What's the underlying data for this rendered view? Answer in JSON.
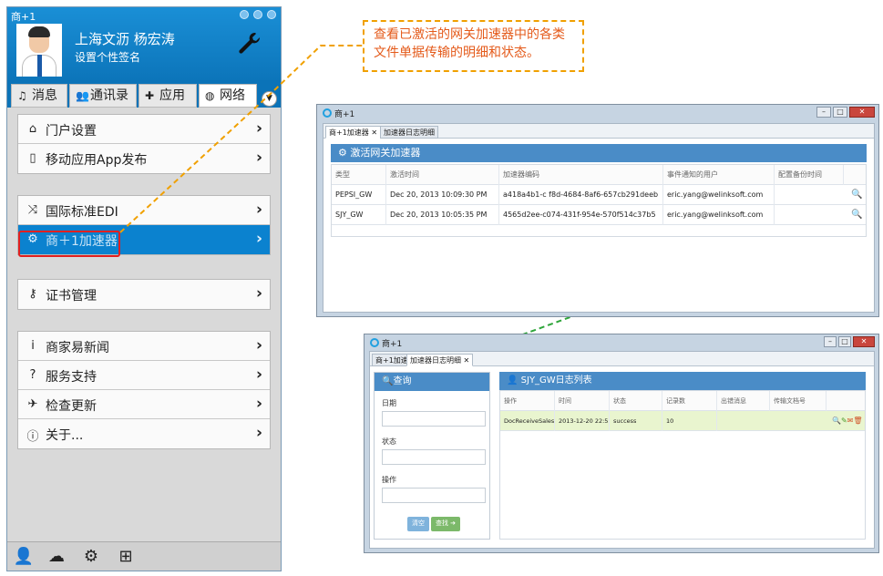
{
  "left_app": {
    "title": "商+1",
    "user_name": "上海文沥 杨宏涛",
    "user_signature": "设置个性签名",
    "tabs": [
      {
        "icon": "bell-icon",
        "label": "消息"
      },
      {
        "icon": "users-icon",
        "label": "通讯录"
      },
      {
        "icon": "puzzle-icon",
        "label": "应用"
      },
      {
        "icon": "globe-icon",
        "label": "网络"
      }
    ],
    "menu_groups": [
      [
        {
          "icon": "home-icon",
          "label": "门户设置"
        },
        {
          "icon": "mobile-icon",
          "label": "移动应用App发布"
        }
      ],
      [
        {
          "icon": "shuffle-icon",
          "label": "国际标准EDI"
        },
        {
          "icon": "gears-icon",
          "label": "商＋1加速器"
        }
      ],
      [
        {
          "icon": "key-icon",
          "label": "证书管理"
        }
      ],
      [
        {
          "icon": "info-i-icon",
          "label": "商家易新闻"
        },
        {
          "icon": "question-icon",
          "label": "服务支持"
        },
        {
          "icon": "plane-icon",
          "label": "检查更新"
        },
        {
          "icon": "info-circle-icon",
          "label": "关于..."
        }
      ]
    ],
    "bottom_icons": [
      "user-icon",
      "cloud-icon",
      "gear-icon",
      "plus-square-icon"
    ]
  },
  "callout": {
    "text": "查看已激活的网关加速器中的各类文件单据传输的明细和状态。"
  },
  "window1": {
    "title": "商+1",
    "tabs": [
      "商+1加速器 ✕",
      "加速器日志明细"
    ],
    "panel_title": "激活网关加速器",
    "columns": [
      "类型",
      "激活时间",
      "加速器编码",
      "事件通知的用户",
      "配置备份时间"
    ],
    "rows": [
      [
        "PEPSI_GW",
        "Dec 20, 2013 10:09:30 PM",
        "a418a4b1-c f8d-4684-8af6-657cb291deeb",
        "eric.yang@welinksoft.com",
        ""
      ],
      [
        "SJY_GW",
        "Dec 20, 2013 10:05:35 PM",
        "4565d2ee-c074-431f-954e-570f514c37b5",
        "eric.yang@welinksoft.com",
        ""
      ]
    ]
  },
  "window2": {
    "title": "商+1",
    "tabs": [
      "商+1加速器",
      "加速器日志明细 ✕"
    ],
    "query_title": "查询",
    "fields": [
      "日期",
      "状态",
      "操作"
    ],
    "clear_label": "清空",
    "search_label": "查找",
    "list_title": "SJY_GW日志列表",
    "columns": [
      "操作",
      "时间",
      "状态",
      "记录数",
      "出错消息",
      "传输文档号"
    ],
    "rows": [
      [
        "DocReceiveSalesOrder",
        "2013-12-20 22:52:48",
        "success",
        "10",
        "",
        ""
      ]
    ]
  },
  "colors": {
    "accent": "#0b73b8",
    "panel_head": "#4a8cc7",
    "callout_border": "#f0a000",
    "callout_text": "#e45a1a",
    "highlight_row": "#e9f5cf",
    "selection_border": "#e02020"
  }
}
